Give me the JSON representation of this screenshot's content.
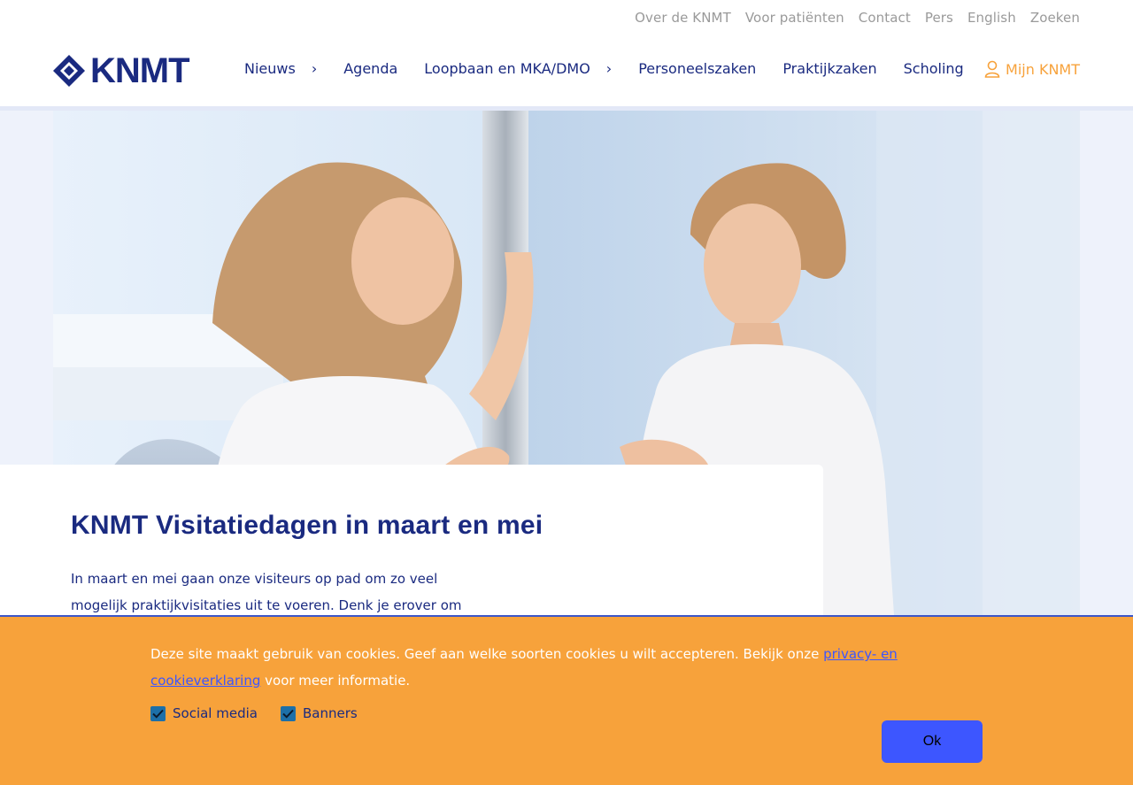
{
  "utility_nav": [
    "Over de KNMT",
    "Voor patiënten",
    "Contact",
    "Pers",
    "English",
    "Zoeken"
  ],
  "logo_text": "KNMT",
  "main_nav": [
    {
      "label": "Nieuws",
      "has_submenu": true
    },
    {
      "label": "Agenda",
      "has_submenu": false
    },
    {
      "label": "Loopbaan en MKA/DMO",
      "has_submenu": true
    },
    {
      "label": "Personeelszaken",
      "has_submenu": false
    },
    {
      "label": "Praktijkzaken",
      "has_submenu": false
    },
    {
      "label": "Scholing",
      "has_submenu": false
    }
  ],
  "account_label": "Mijn KNMT",
  "article": {
    "title": "KNMT Visitatiedagen in maart en mei",
    "intro": "In maart en mei gaan onze visiteurs op pad om zo veel mogelijk praktijkvisitaties uit te voeren. Denk je erover om je"
  },
  "cookie": {
    "text_before": "Deze site maakt gebruik van cookies. Geef aan welke soorten cookies u wilt accepteren. Bekijk onze ",
    "link": "privacy- en cookieverklaring",
    "text_after": " voor meer informatie.",
    "options": [
      {
        "label": "Social media",
        "checked": true
      },
      {
        "label": "Banners",
        "checked": true
      }
    ],
    "ok_label": "Ok"
  },
  "colors": {
    "brand_navy": "#1a2a80",
    "accent_orange": "#f7a23b",
    "button_blue": "#3d56ff"
  }
}
